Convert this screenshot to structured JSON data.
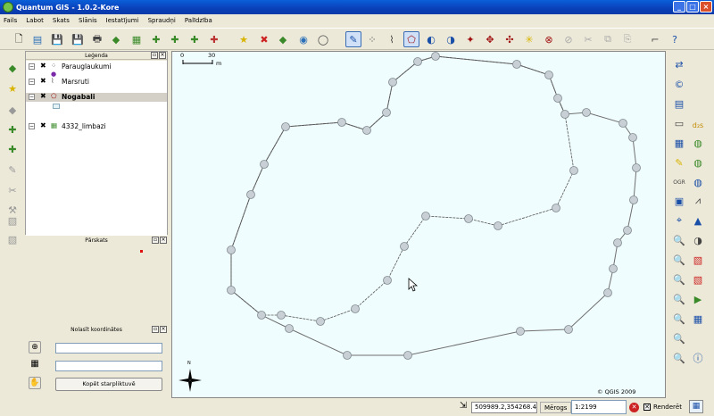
{
  "window": {
    "title": "Quantum GIS - 1.0.2-Kore"
  },
  "menu": [
    "Fails",
    "Labot",
    "Skats",
    "Slānis",
    "Iestatījumi",
    "Spraudņi",
    "Palīdzība"
  ],
  "legend": {
    "title": "Leģenda",
    "layers": [
      {
        "name": "Parauglaukumi",
        "bold": false
      },
      {
        "name": "Marsruti",
        "bold": false
      },
      {
        "name": "Nogabali",
        "bold": true,
        "selected": true
      },
      {
        "name": "4332_limbazi",
        "bold": false
      }
    ]
  },
  "overview": {
    "title": "Pārskats"
  },
  "coords_panel": {
    "title": "Nolasīt koordinātes",
    "copy_button": "Kopēt starpliktuvē",
    "input1": "",
    "input2": ""
  },
  "map": {
    "scalebar_left": "0",
    "scalebar_right": "30",
    "scalebar_unit": "m",
    "north_label": "N",
    "copyright": "© QGIS 2009"
  },
  "status": {
    "coordinates": "509989.2,354268.4",
    "scale_label": "Mērogs",
    "scale_value": "1:2199",
    "render_label": "Renderēt"
  },
  "colors": {
    "canvas_bg": "#f0fdfe",
    "title_bar": "#0a3fb8",
    "vertex_fill": "#c8d0d6",
    "selected_layer_bg": "#d4d0c8"
  }
}
